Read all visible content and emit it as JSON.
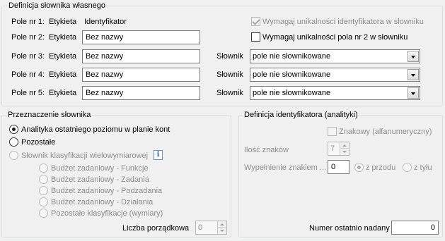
{
  "definicja_slownika": {
    "title": "Definicja słownika własnego",
    "field_label": "Etykieta",
    "rows": [
      {
        "pole": "Pole nr 1:",
        "etykieta": "Etykieta",
        "value": "Identyfikator"
      },
      {
        "pole": "Pole nr 2:",
        "etykieta": "Etykieta",
        "value": "Bez nazwy"
      },
      {
        "pole": "Pole nr 3:",
        "etykieta": "Etykieta",
        "value": "Bez nazwy",
        "slownik_label": "Słownik",
        "slownik_value": "pole nie słownikowane"
      },
      {
        "pole": "Pole nr 4:",
        "etykieta": "Etykieta",
        "value": "Bez nazwy",
        "slownik_label": "Słownik",
        "slownik_value": "pole nie słownikowane"
      },
      {
        "pole": "Pole nr 5:",
        "etykieta": "Etykieta",
        "value": "Bez nazwy",
        "slownik_label": "Słownik",
        "slownik_value": "pole nie słownikowane"
      }
    ],
    "wymagaj_unikalnosci_id": {
      "label": "Wymagaj unikalności identyfikatora w słowniku",
      "checked": true,
      "enabled": false
    },
    "wymagaj_unikalnosci_pole2": {
      "label": "Wymagaj unikalności pola nr 2 w słowniku",
      "checked": false,
      "enabled": true
    }
  },
  "przeznaczenie": {
    "title": "Przeznaczenie słownika",
    "options": [
      {
        "label": "Analityka ostatniego poziomu w planie kont",
        "selected": true,
        "enabled": true
      },
      {
        "label": "Pozostałe",
        "selected": false,
        "enabled": true
      },
      {
        "label": "Słownik klasyfikacji wielowymiarowej",
        "selected": false,
        "enabled": false
      }
    ],
    "info_icon": "info-icon",
    "info_glyph": "i",
    "sub_options": [
      "Budżet zadaniowy - Funkcje",
      "Budżet zadaniowy - Zadania",
      "Budżet zadaniowy - Podzadania",
      "Budżet zadaniowy - Działania",
      "Pozostałe klasyfikacje (wymiary)"
    ],
    "liczba_porzadkowa_label": "Liczba porządkowa",
    "liczba_porzadkowa_value": "0"
  },
  "definicja_identyfikatora": {
    "title": "Definicja identyfikatora (analityki)",
    "znakowy_label": "Znakowy (alfanumeryczny)",
    "znakowy_checked": false,
    "ilosc_znakow_label": "Ilość znaków",
    "ilosc_znakow_value": "7",
    "wypelnienie_label": "Wypełnienie znakiem ...",
    "wypelnienie_value": "0",
    "z_przodu_label": "z przodu",
    "z_przodu_selected": true,
    "z_tylu_label": "z tyłu",
    "z_tylu_selected": false,
    "numer_label": "Numer ostatnio nadany",
    "numer_value": "0"
  }
}
